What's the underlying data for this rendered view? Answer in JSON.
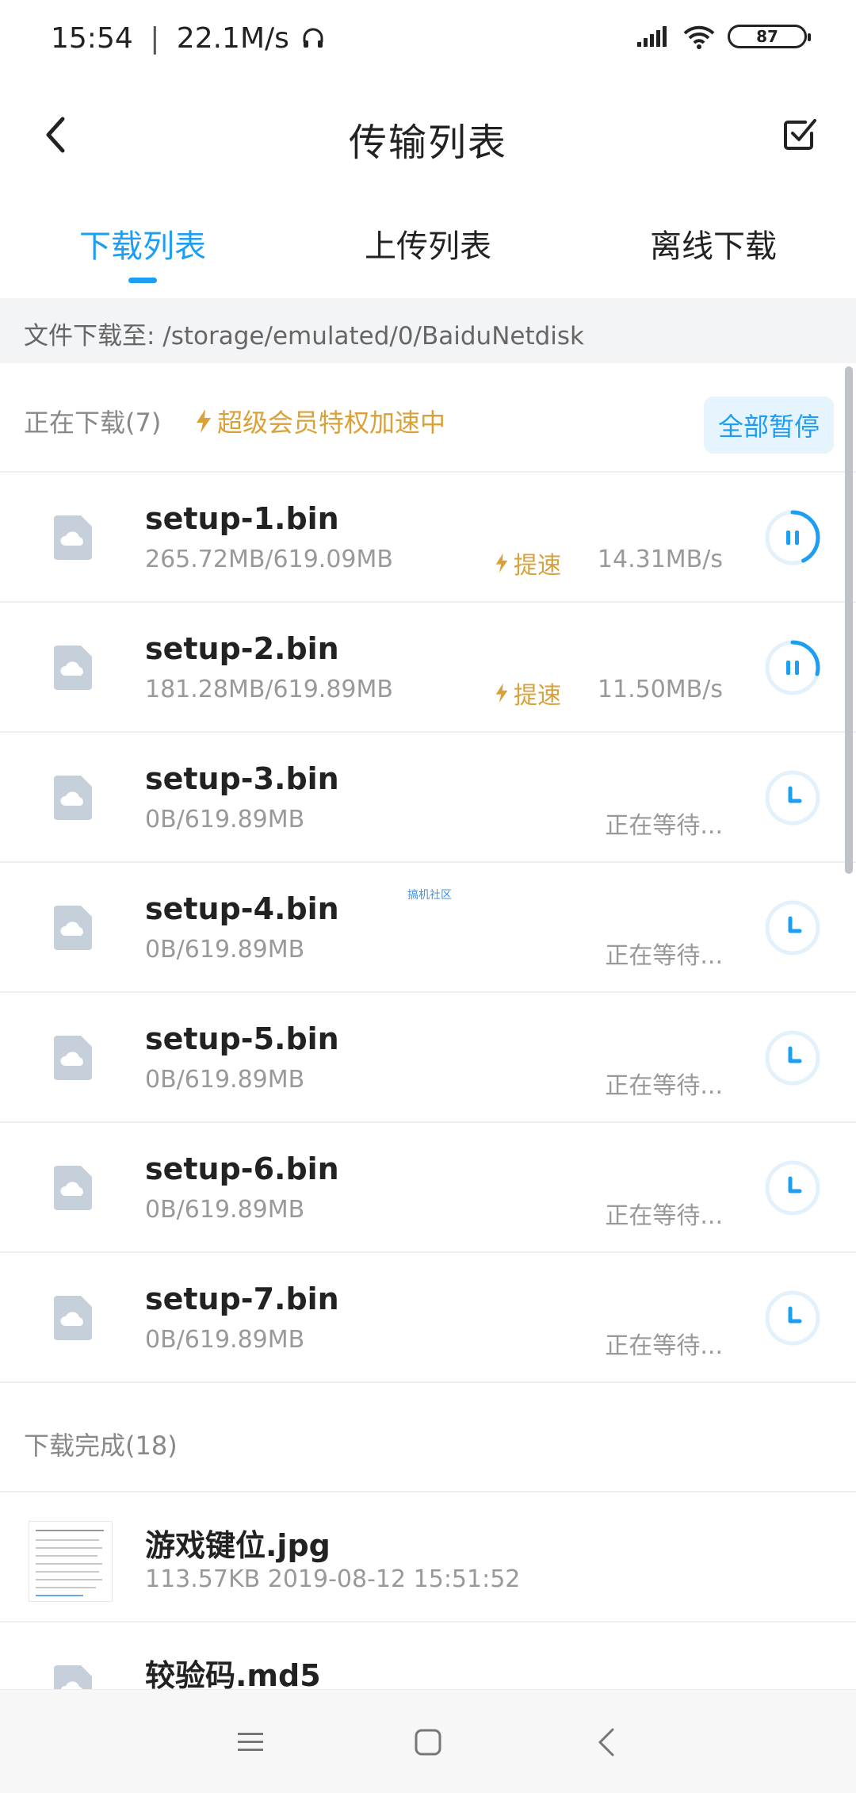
{
  "status_bar": {
    "time": "15:54",
    "separator": "|",
    "net_speed": "22.1M/s",
    "battery": "87",
    "icons": [
      "headphones-icon",
      "signal-icon",
      "wifi-icon",
      "battery-icon"
    ]
  },
  "header": {
    "title": "传输列表",
    "back_icon": "chevron-left-icon",
    "select_icon": "checkbox-edit-icon"
  },
  "tabs": [
    {
      "label": "下载列表",
      "active": true
    },
    {
      "label": "上传列表",
      "active": false
    },
    {
      "label": "离线下载",
      "active": false
    }
  ],
  "download_path": "文件下载至: /storage/emulated/0/BaiduNetdisk",
  "downloading": {
    "title": "正在下载(7)",
    "vip_note": "超级会员特权加速中",
    "pause_all_label": "全部暂停",
    "items": [
      {
        "name": "setup-1.bin",
        "size": "265.72MB/619.09MB",
        "boost": "提速",
        "speed": "14.31MB/s",
        "status": "downloading",
        "progress": 0.43
      },
      {
        "name": "setup-2.bin",
        "size": "181.28MB/619.89MB",
        "boost": "提速",
        "speed": "11.50MB/s",
        "status": "downloading",
        "progress": 0.29
      },
      {
        "name": "setup-3.bin",
        "size": "0B/619.89MB",
        "status_text": "正在等待...",
        "status": "waiting"
      },
      {
        "name": "setup-4.bin",
        "size": "0B/619.89MB",
        "status_text": "正在等待...",
        "status": "waiting"
      },
      {
        "name": "setup-5.bin",
        "size": "0B/619.89MB",
        "status_text": "正在等待...",
        "status": "waiting"
      },
      {
        "name": "setup-6.bin",
        "size": "0B/619.89MB",
        "status_text": "正在等待...",
        "status": "waiting"
      },
      {
        "name": "setup-7.bin",
        "size": "0B/619.89MB",
        "status_text": "正在等待...",
        "status": "waiting"
      }
    ]
  },
  "completed": {
    "title": "下载完成(18)",
    "items": [
      {
        "name": "游戏键位.jpg",
        "meta": "113.57KB 2019-08-12 15:51:52"
      },
      {
        "name": "较验码.md5",
        "meta": ""
      }
    ]
  },
  "watermark": "搞机社区",
  "nav": [
    "menu-icon",
    "home-square-icon",
    "back-chevron-icon"
  ],
  "colors": {
    "accent": "#1e9ef3",
    "vip": "#d9a13a",
    "muted": "#999999"
  }
}
